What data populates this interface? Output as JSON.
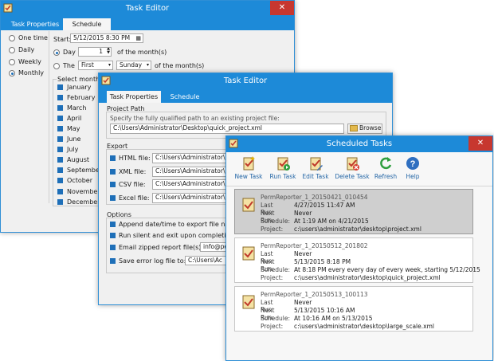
{
  "window1": {
    "title": "Task Editor",
    "close": "✕",
    "tabs": [
      "Task Properties",
      "Schedule"
    ],
    "freq": [
      "One time",
      "Daily",
      "Weekly",
      "Monthly"
    ],
    "start_label": "Start:",
    "start_value": "5/12/2015 8:30 PM",
    "day_label": "Day",
    "day_value": "1",
    "of_months": "of the month(s)",
    "the_label": "The",
    "the_ordinal": "First",
    "the_weekday": "Sunday",
    "of_months2": "of the month(s)",
    "select_months": "Select months",
    "months": [
      "January",
      "February",
      "March",
      "April",
      "May",
      "June",
      "July",
      "August",
      "September",
      "October",
      "November",
      "December"
    ]
  },
  "window2": {
    "title": "Task Editor",
    "close": "✕",
    "tabs": [
      "Task Properties",
      "Schedule"
    ],
    "project_path": "Project Path",
    "specify": "Specify the fully qualified path to an existing project file:",
    "path_value": "C:\\Users\\Administrator\\Desktop\\quick_project.xml",
    "browse": "Browse",
    "export": "Export",
    "export_items": [
      {
        "label": "HTML file:",
        "value": "C:\\Users\\Administrator\\Des"
      },
      {
        "label": "XML file:",
        "value": "C:\\Users\\Administrator\\Des"
      },
      {
        "label": "CSV file:",
        "value": "C:\\Users\\Administrator\\Des"
      },
      {
        "label": "Excel file:",
        "value": "C:\\Users\\Administrator\\Des"
      }
    ],
    "options": "Options",
    "opt1": "Append date/time to export file names",
    "opt2": "Run silent and exit upon completion",
    "opt3": "Email zipped report file(s) to:",
    "opt3_value": "info@per",
    "opt4": "Save error log file to:",
    "opt4_value": "C:\\Users\\Ac"
  },
  "window3": {
    "title": "Scheduled Tasks",
    "close": "✕",
    "toolbar": [
      "New Task",
      "Run Task",
      "Edit Task",
      "Delete Task",
      "Refresh",
      "Help"
    ],
    "keys": {
      "last": "Last Run:",
      "next": "Next Run:",
      "schedule": "Schedule:",
      "project": "Project:"
    },
    "tasks": [
      {
        "name": "PermReporter_1_20150421_010454",
        "last": "4/27/2015 11:47 AM",
        "next": "Never",
        "schedule": "At 1:19 AM on 4/21/2015",
        "project": "c:\\users\\administrator\\desktop\\project.xml"
      },
      {
        "name": "PermReporter_1_20150512_201802",
        "last": "Never",
        "next": "5/13/2015 8:18 PM",
        "schedule": "At 8:18 PM every every day of every week, starting 5/12/2015",
        "project": "c:\\users\\administrator\\desktop\\quick_project.xml"
      },
      {
        "name": "PermReporter_1_20150513_100113",
        "last": "Never",
        "next": "5/13/2015 10:16 AM",
        "schedule": "At 10:16 AM on 5/13/2015",
        "project": "c:\\users\\administrator\\desktop\\large_scale.xml"
      }
    ]
  },
  "colors": {
    "titlebar": "#1d8ad8",
    "close": "#c7372f",
    "accent": "#1e6fb8",
    "link": "#2466a6"
  }
}
